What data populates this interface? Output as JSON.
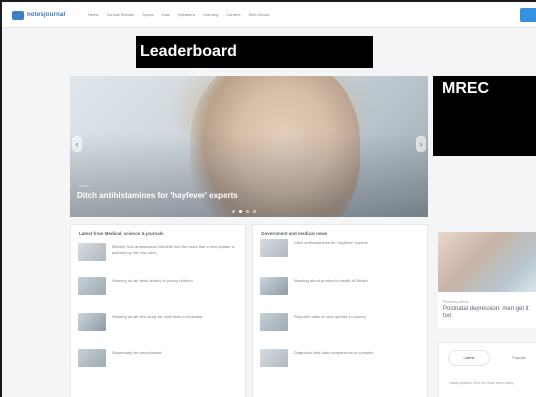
{
  "site": {
    "logo_text": "notesjournal"
  },
  "nav": {
    "items": [
      "Home",
      "Clinical Results",
      "Topics",
      "Jobs",
      "Speakers",
      "Learning",
      "Careers",
      "Web eBook"
    ]
  },
  "ads": {
    "leaderboard": "Leaderboard",
    "mrec": "MREC"
  },
  "hero": {
    "tag": "News",
    "title": "Ditch antihistamines for 'hayfever' experts",
    "slides": 4,
    "active_slide": 1
  },
  "columns": {
    "left": {
      "heading": "Latest from Medical, science & journals",
      "articles": [
        "Midwife Nuri ambassador Michelle told the news that a new update is planned by the new rules",
        "Warning as lab tests deaths of young children",
        "Warning as lab test study for child tests in Australia",
        "Dispensary fee unexplained"
      ]
    },
    "right": {
      "heading": "Government and medical news",
      "articles": [
        "Ditch antihistamines for 'hayfever' experts",
        "Warning about product to health of Britain",
        "Reported case of virus spread in country",
        "Diagnostic test data comparisons to complex"
      ]
    }
  },
  "promo": {
    "tag": "Pharmacy News",
    "title": "Postnatal depression: men get it too"
  },
  "tabs": {
    "items": [
      "Latest",
      "Popular"
    ],
    "preview": "Latest updates from the news team today"
  },
  "colors": {
    "accent": "#3791e0",
    "ad_background": "#000000"
  }
}
